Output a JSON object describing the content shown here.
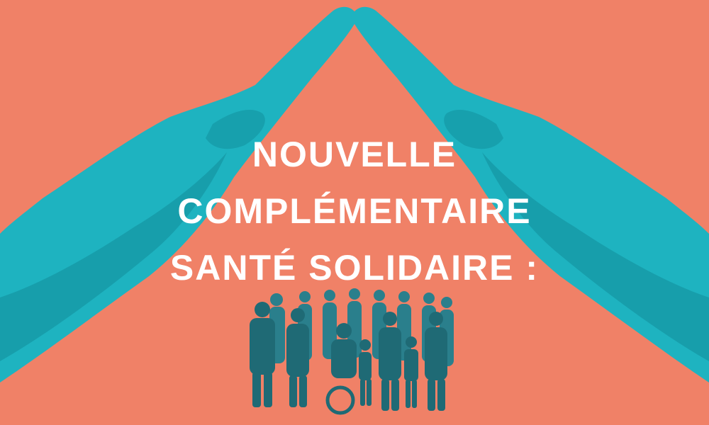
{
  "poster": {
    "headline": [
      "NOUVELLE",
      "COMPLÉMENTAIRE",
      "SANTÉ SOLIDAIRE :"
    ]
  },
  "colors": {
    "background": "#f08167",
    "hands": "#1eb3c0",
    "hands_shadow": "#138c99",
    "people": "#2a7f8c",
    "text": "#ffffff"
  },
  "imagery": {
    "hands": "roof-shaped-hands-illustration",
    "group": "group-of-people-illustration"
  }
}
